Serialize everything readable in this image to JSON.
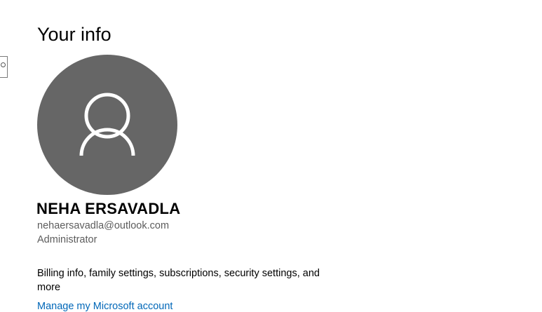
{
  "page": {
    "title": "Your info"
  },
  "user": {
    "avatar_icon": "person-icon",
    "name": "NEHA ERSAVADLA",
    "email": "nehaersavadla@outlook.com",
    "role": "Administrator"
  },
  "account": {
    "billing_text": "Billing info, family settings, subscriptions, security settings, and more",
    "manage_link": "Manage my Microsoft account"
  },
  "colors": {
    "accent_link": "#0067b8",
    "avatar_bg": "#666666",
    "secondary_text": "#5c5c5c"
  }
}
